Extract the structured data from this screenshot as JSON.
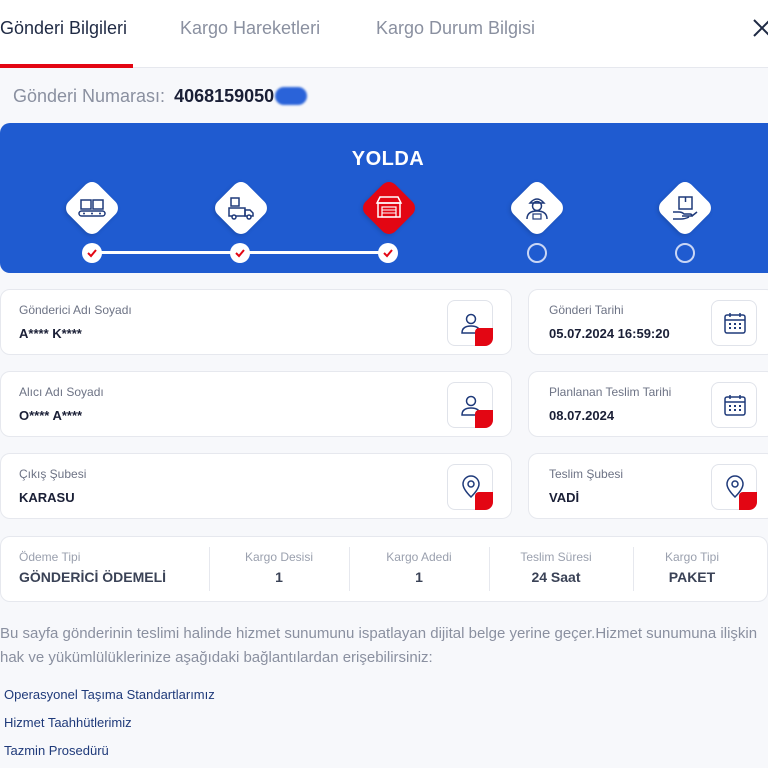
{
  "tabs": [
    {
      "label": "Gönderi Bilgileri",
      "active": true
    },
    {
      "label": "Kargo Hareketleri",
      "active": false
    },
    {
      "label": "Kargo Durum Bilgisi",
      "active": false
    }
  ],
  "shipment": {
    "label": "Gönderi Numarası:",
    "number": "4068159050"
  },
  "status": {
    "title": "YOLDA",
    "current_step": 3,
    "total_steps": 5,
    "step_icons": [
      "conveyor-boxes-icon",
      "delivery-truck-icon",
      "branch-store-icon",
      "courier-person-icon",
      "hand-package-icon"
    ]
  },
  "cards": {
    "sender_name": {
      "label": "Gönderici Adı Soyadı",
      "value": "A**** K****",
      "icon": "user-out-icon"
    },
    "ship_date": {
      "label": "Gönderi Tarihi",
      "value": "05.07.2024 16:59:20",
      "icon": "calendar-icon"
    },
    "receiver_name": {
      "label": "Alıcı Adı Soyadı",
      "value": "O**** A****",
      "icon": "user-in-icon"
    },
    "planned_delivery": {
      "label": "Planlanan Teslim Tarihi",
      "value": "08.07.2024",
      "icon": "calendar-icon"
    },
    "origin_branch": {
      "label": "Çıkış Şubesi",
      "value": "KARASU",
      "icon": "location-out-icon"
    },
    "delivery_branch": {
      "label": "Teslim Şubesi",
      "value": "VADİ",
      "icon": "location-in-icon"
    }
  },
  "summary": [
    {
      "label": "Ödeme Tipi",
      "value": "GÖNDERİCİ ÖDEMELİ"
    },
    {
      "label": "Kargo Desisi",
      "value": "1"
    },
    {
      "label": "Kargo Adedi",
      "value": "1"
    },
    {
      "label": "Teslim Süresi",
      "value": "24 Saat"
    },
    {
      "label": "Kargo Tipi",
      "value": "PAKET"
    }
  ],
  "info_text": "Bu sayfa gönderinin teslimi halinde hizmet sunumunu ispatlayan dijital belge yerine geçer.Hizmet sunumuna ilişkin hak ve yükümlülüklerinize aşağıdaki bağlantılardan erişebilirsiniz:",
  "links": [
    "Operasyonel Taşıma Standartlarımız",
    "Hizmet Taahhütlerimiz",
    "Tazmin Prosedürü"
  ],
  "colors": {
    "brand_blue": "#1f5bd0",
    "brand_red": "#e30613",
    "text_dark": "#1a1f36",
    "text_muted": "#8a90a0"
  }
}
